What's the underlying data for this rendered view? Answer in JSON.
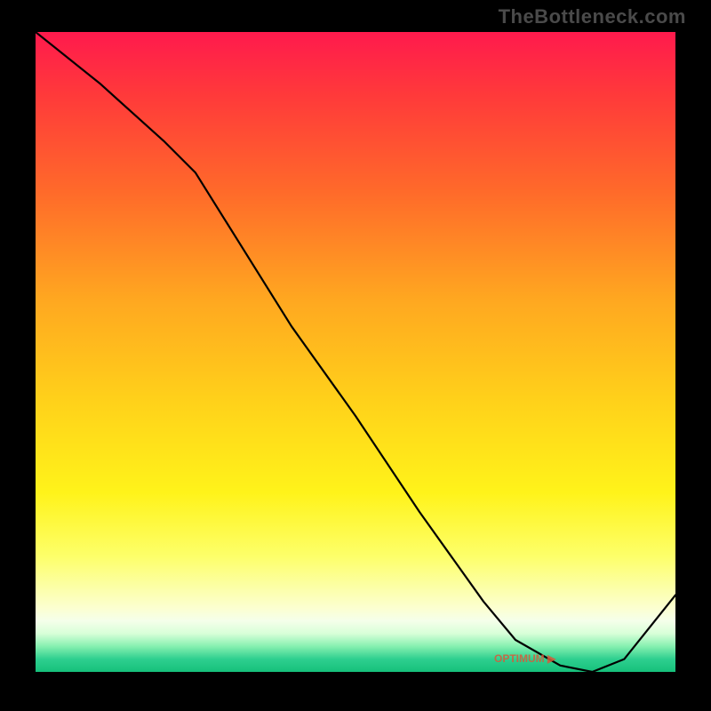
{
  "watermark": "TheBottleneck.com",
  "chart_data": {
    "type": "line",
    "title": "",
    "xlabel": "",
    "ylabel": "",
    "xlim": [
      0,
      100
    ],
    "ylim": [
      0,
      100
    ],
    "x": [
      0,
      10,
      20,
      25,
      30,
      40,
      50,
      60,
      70,
      75,
      82,
      87,
      92,
      100
    ],
    "values": [
      100,
      92,
      83,
      78,
      70,
      54,
      40,
      25,
      11,
      5,
      1,
      0,
      2,
      12
    ],
    "annotations": [
      {
        "text": "OPTIMUM ▶",
        "x": 80,
        "y": 2
      }
    ],
    "background_gradient": {
      "orientation": "vertical",
      "stops": [
        {
          "pos": 0.0,
          "color": "#ff1a4d"
        },
        {
          "pos": 0.5,
          "color": "#ffd21a"
        },
        {
          "pos": 0.9,
          "color": "#fcffd0"
        },
        {
          "pos": 1.0,
          "color": "#16c07b"
        }
      ]
    }
  }
}
